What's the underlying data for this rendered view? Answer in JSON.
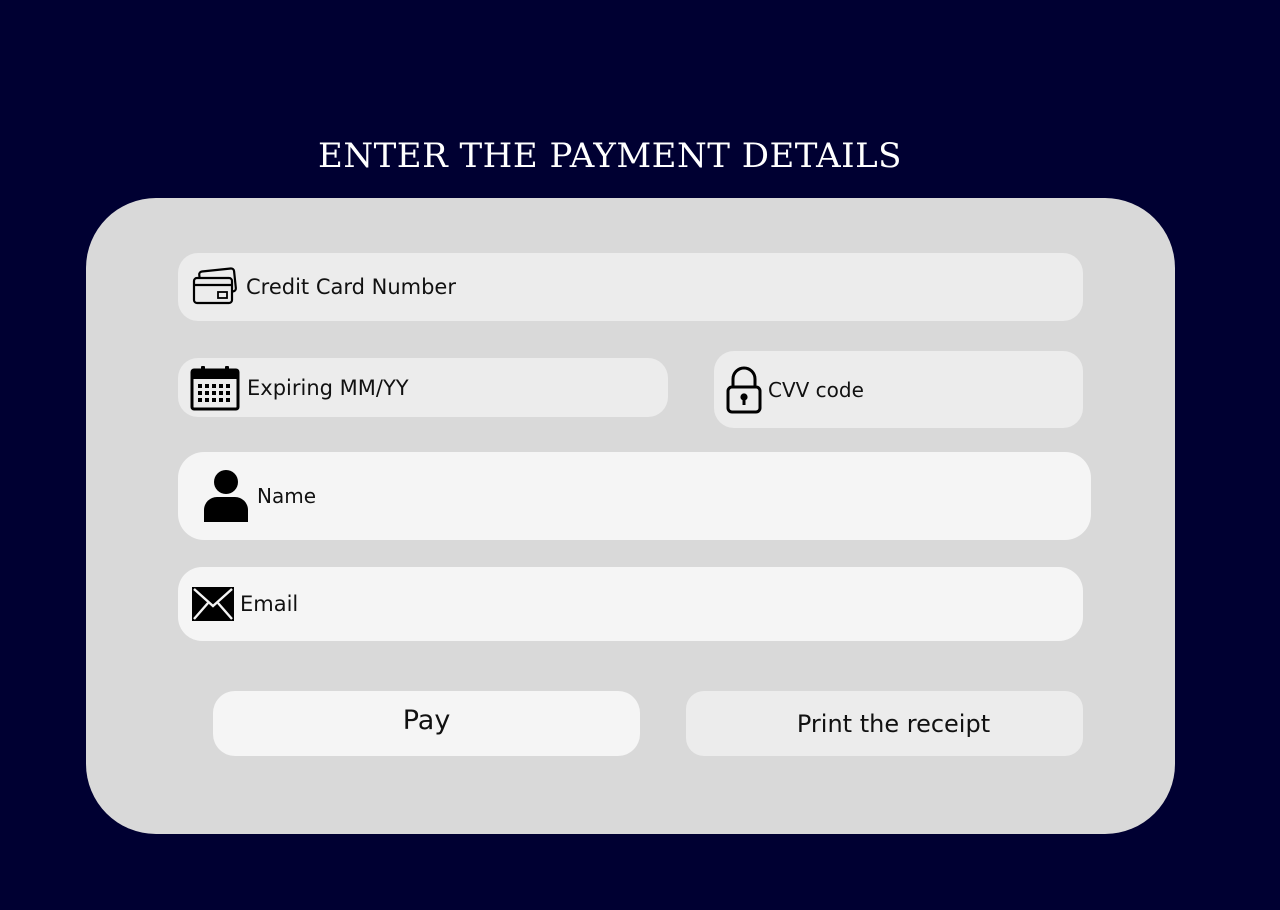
{
  "colors": {
    "background": "#000032",
    "title_text": "#ffffff",
    "card": "#d9d9d9",
    "field_light": "#ececec",
    "field_lighter": "#f5f5f5",
    "text": "#111111",
    "icon": "#000000"
  },
  "page": {
    "title": "ENTER THE PAYMENT DETAILS"
  },
  "form": {
    "card_number": {
      "placeholder": "Credit Card Number",
      "icon": "credit-card-icon"
    },
    "expiry": {
      "placeholder": "Expiring MM/YY",
      "icon": "calendar-icon"
    },
    "cvv": {
      "placeholder": "CVV code",
      "icon": "lock-icon"
    },
    "name": {
      "placeholder": "Name",
      "icon": "user-icon"
    },
    "email": {
      "placeholder": "Email",
      "icon": "envelope-icon"
    }
  },
  "actions": {
    "pay_label": "Pay",
    "print_label": "Print the receipt"
  }
}
